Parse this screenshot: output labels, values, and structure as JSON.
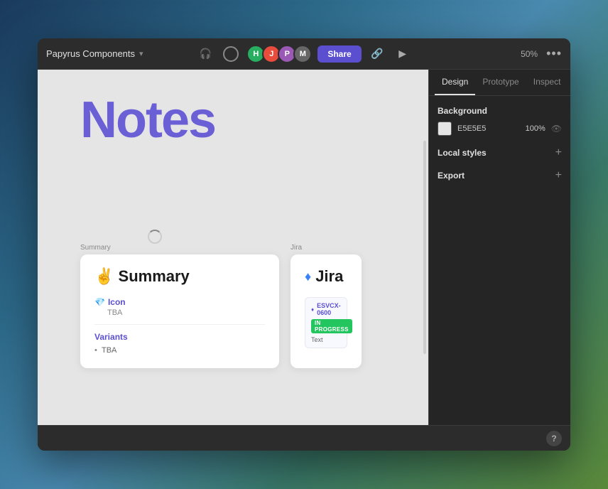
{
  "background": {
    "gradient": "linear-gradient(135deg, #1a3a5c 0%, #2d6a8a 30%, #4a8ab0 50%, #3a7a6a 70%, #5a8a3a 100%)"
  },
  "titlebar": {
    "project_name": "Papyrus Components",
    "chevron": "›",
    "share_label": "Share",
    "zoom_label": "50%",
    "more_icon": "•••"
  },
  "avatars": [
    {
      "initials": "🎧",
      "color": "#555",
      "is_icon": true
    },
    {
      "initials": "",
      "color": "#666",
      "is_profile": true
    },
    {
      "initials": "H",
      "color": "#2ecc71"
    },
    {
      "initials": "J",
      "color": "#e74c3c"
    },
    {
      "initials": "P",
      "color": "#9b59b6"
    },
    {
      "initials": "M",
      "color": "#555"
    }
  ],
  "canvas": {
    "background": "#e5e5e5",
    "title": "Notes",
    "title_color": "#6b5fd6"
  },
  "summary_card": {
    "label": "Summary",
    "emoji": "✌️",
    "title": "Summary",
    "icon_label": "Icon",
    "icon_emoji": "💎",
    "icon_value": "TBA",
    "variants_label": "Variants",
    "variant_item": "TBA"
  },
  "jira_card": {
    "label": "Jira",
    "diamond": "♦",
    "title": "Jira",
    "ticket_id": "ESVCX-0600",
    "ticket_status": "IN PROGRESS",
    "ticket_text": "Text"
  },
  "right_panel": {
    "tabs": [
      {
        "label": "Design",
        "active": true
      },
      {
        "label": "Prototype",
        "active": false
      },
      {
        "label": "Inspect",
        "active": false
      }
    ],
    "background_section": {
      "title": "Background",
      "color_value": "E5E5E5",
      "opacity": "100%"
    },
    "local_styles_section": {
      "title": "Local styles"
    },
    "export_section": {
      "title": "Export"
    }
  },
  "bottom_bar": {
    "help_label": "?"
  }
}
